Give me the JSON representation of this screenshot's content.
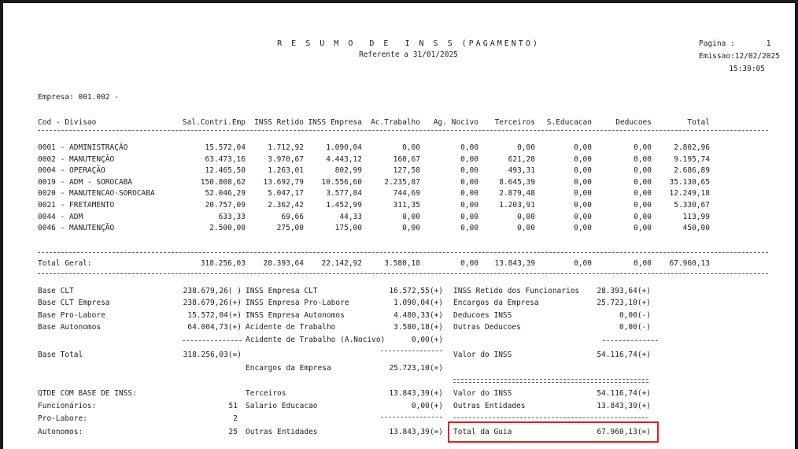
{
  "header": {
    "title": "R E S U M O  D E  I N S S (PAGAMENTO)",
    "reference": "Referente a 31/01/2025",
    "page": "Pagina :       1",
    "emission": "Emissao:12/02/2025",
    "time": "15:39:05",
    "company": "Empresa: 001.002 -"
  },
  "table": {
    "columns": [
      "Cod - Divisao",
      "Sal.Contri.Emp",
      "INSS Retido",
      "INSS Empresa",
      "Ac.Trabalho",
      "Ag. Nocivo",
      "Terceiros",
      "S.Educacao",
      "Deducoes",
      "Total"
    ],
    "rows": [
      [
        "0001 - ADMINISTRAÇÃO",
        "15.572,04",
        "1.712,92",
        "1.090,04",
        "0,00",
        "0,00",
        "0,00",
        "0,00",
        "0,00",
        "2.802,96"
      ],
      [
        "0002 - MANUTENÇÃO",
        "63.473,16",
        "3.970,67",
        "4.443,12",
        "160,67",
        "0,00",
        "621,28",
        "0,00",
        "0,00",
        "9.195,74"
      ],
      [
        "0004 - OPERAÇÃO",
        "12.465,50",
        "1.263,01",
        "802,99",
        "127,58",
        "0,00",
        "493,31",
        "0,00",
        "0,00",
        "2.686,89"
      ],
      [
        "0019 - ADM - SOROCABA",
        "150.808,62",
        "13.692,79",
        "10.556,60",
        "2.235,87",
        "0,00",
        "8.645,39",
        "0,00",
        "0,00",
        "35.130,65"
      ],
      [
        "0020 - MANUTENCAO-SOROCABA",
        "52.046,29",
        "5.047,17",
        "3.577,84",
        "744,69",
        "0,00",
        "2.879,48",
        "0,00",
        "0,00",
        "12.249,18"
      ],
      [
        "0021 - FRETAMENTO",
        "20.757,09",
        "2.362,42",
        "1.452,99",
        "311,35",
        "0,00",
        "1.203,91",
        "0,00",
        "0,00",
        "5.330,67"
      ],
      [
        "0044 - ADM",
        "633,33",
        "69,66",
        "44,33",
        "0,00",
        "0,00",
        "0,00",
        "0,00",
        "0,00",
        "113,99"
      ],
      [
        "0046 - MANUTENÇÃO",
        "2.500,00",
        "275,00",
        "175,00",
        "0,00",
        "0,00",
        "0,00",
        "0,00",
        "0,00",
        "450,00"
      ]
    ],
    "total": {
      "label": "Total Geral:",
      "values": [
        "318.256,03",
        "28.393,64",
        "22.142,92",
        "3.580,18",
        "0,00",
        "13.843,39",
        "0,00",
        "0,00",
        "67.960,13"
      ]
    }
  },
  "summary": {
    "col1": [
      {
        "label": "Base CLT",
        "value": "238.679,26( )"
      },
      {
        "label": "Base CLT Empresa",
        "value": "238.679,26(+)"
      },
      {
        "label": "Base Pro-Labore",
        "value": "15.572,04(+)"
      },
      {
        "label": "Base Autonomos",
        "value": "64.004,73(+)"
      },
      {
        "label": "Base Total",
        "value": "318.256,03(=)"
      }
    ],
    "col2": [
      {
        "label": "INSS Empresa CLT",
        "value": "16.572,55(+)"
      },
      {
        "label": "INSS Empresa Pro-Labore",
        "value": "1.090,04(+)"
      },
      {
        "label": "INSS Empresa Autonomos",
        "value": "4.480,33(+)"
      },
      {
        "label": "Acidente de Trabalho",
        "value": "3.580,18(+)"
      },
      {
        "label": "Acidente de Trabalho (A.Nocivo)",
        "value": "0,00(+)"
      },
      {
        "label": "Encargos da Empresa",
        "value": "25.723,10(=)"
      }
    ],
    "col3": [
      {
        "label": "INSS Retido dos Funcionarios",
        "value": "28.393,64(+)"
      },
      {
        "label": "Encargos da Empresa",
        "value": "25.723,10(+)"
      },
      {
        "label": "Deducoes INSS",
        "value": "0,00(-)"
      },
      {
        "label": "Outras Deducoes",
        "value": "0,00(-)"
      },
      {
        "label": "Valor do INSS",
        "value": "54.116,74(+)"
      }
    ],
    "qtde": {
      "title": "QTDE COM BASE DE INSS:",
      "items": [
        {
          "label": "Funcionários:",
          "value": "51"
        },
        {
          "label": "Pro-Labore:",
          "value": "2"
        },
        {
          "label": "Autonomos:",
          "value": "25"
        }
      ]
    },
    "col2b": [
      {
        "label": "Terceiros",
        "value": "13.843,39(+)"
      },
      {
        "label": "Salario Educacao",
        "value": "0,00(+)"
      },
      {
        "label": "Outras Entidades",
        "value": "13.843,39(=)"
      }
    ],
    "col3b": [
      {
        "label": "Valor do INSS",
        "value": "54.116,74(+)"
      },
      {
        "label": "Outras Entidades",
        "value": "13.843,39(+)"
      }
    ],
    "guia": {
      "label": "Total da Guia",
      "value": "67.960,13(=)"
    }
  },
  "colors": {
    "highlight": "#e02020"
  }
}
